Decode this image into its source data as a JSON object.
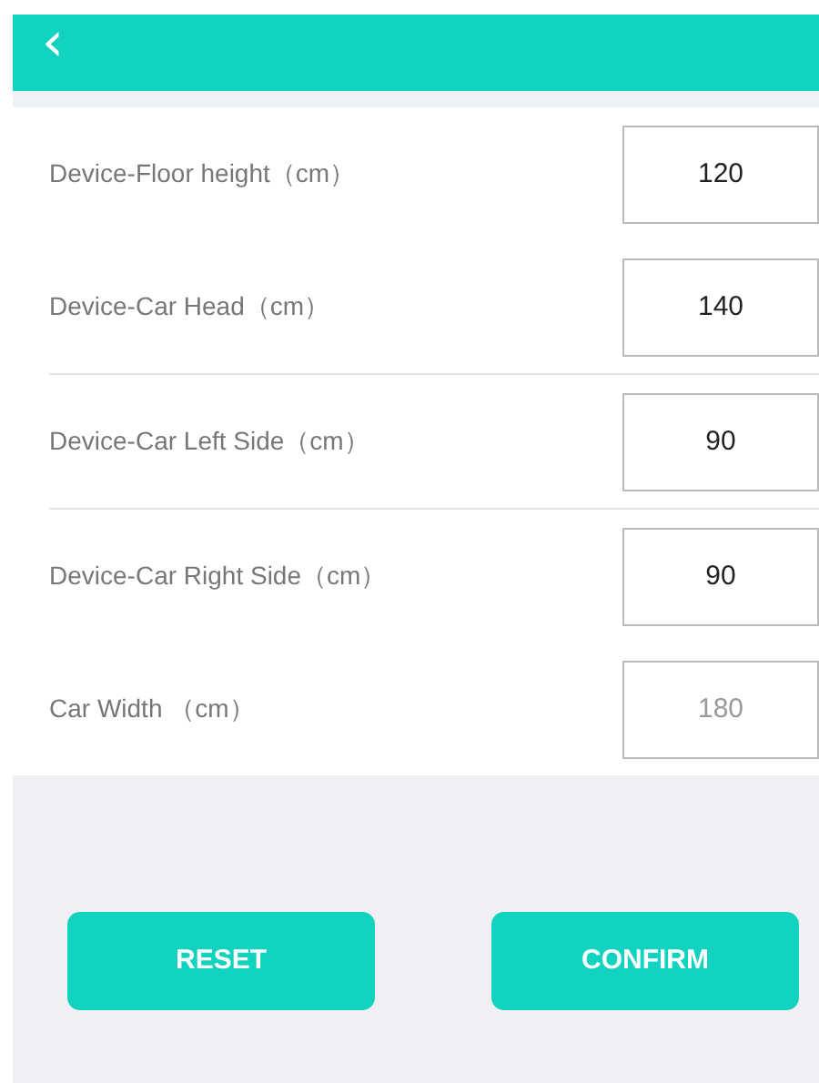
{
  "header": {
    "back": "‹"
  },
  "fields": [
    {
      "label": "Device-Floor height（cm）",
      "value": "120",
      "disabled": false,
      "divider_below": false
    },
    {
      "label": "Device-Car Head（cm）",
      "value": "140",
      "disabled": false,
      "divider_below": true
    },
    {
      "label": "Device-Car Left Side（cm）",
      "value": "90",
      "disabled": false,
      "divider_below": true
    },
    {
      "label": "Device-Car Right Side（cm）",
      "value": "90",
      "disabled": false,
      "divider_below": false
    },
    {
      "label": "Car Width （cm）",
      "value": "180",
      "disabled": true,
      "divider_below": false
    }
  ],
  "buttons": [
    "RESET",
    "CONFIRM"
  ]
}
